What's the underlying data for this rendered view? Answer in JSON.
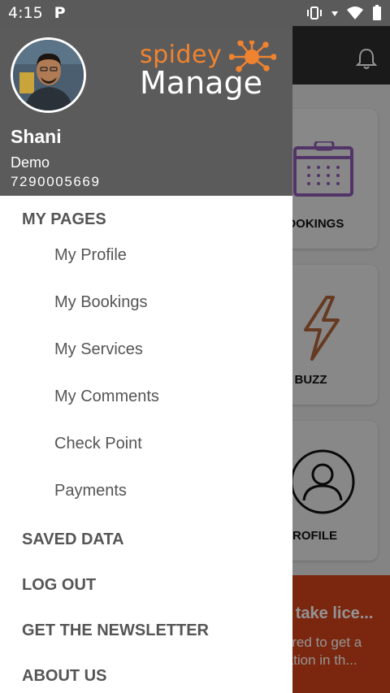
{
  "status_bar": {
    "time": "4:15",
    "app_icon": "parking-p-icon"
  },
  "header": {
    "logo_top": "spidey",
    "logo_bottom": "Manage",
    "user_name": "Shani",
    "user_role": "Demo",
    "user_phone": "7290005669"
  },
  "menu": {
    "my_pages": "MY PAGES",
    "items": [
      "My Profile",
      "My Bookings",
      "My Services",
      "My Comments",
      "Check Point",
      "Payments"
    ],
    "saved_data": "SAVED DATA",
    "log_out": "LOG OUT",
    "newsletter": "GET THE NEWSLETTER",
    "about_us": "ABOUT US"
  },
  "background": {
    "cards": [
      {
        "label": "BOOKINGS",
        "icon": "calendar-icon"
      },
      {
        "label": "BUZZ",
        "icon": "lightning-icon"
      },
      {
        "label": "PROFILE",
        "icon": "user-icon"
      }
    ],
    "banner_line1": "o take lice...",
    "banner_line2": "uired to get a",
    "banner_line3": "ration in th..."
  },
  "colors": {
    "brand_orange": "#f0832f",
    "header_gray": "#5b5b5b",
    "banner_red": "#d4441a"
  }
}
